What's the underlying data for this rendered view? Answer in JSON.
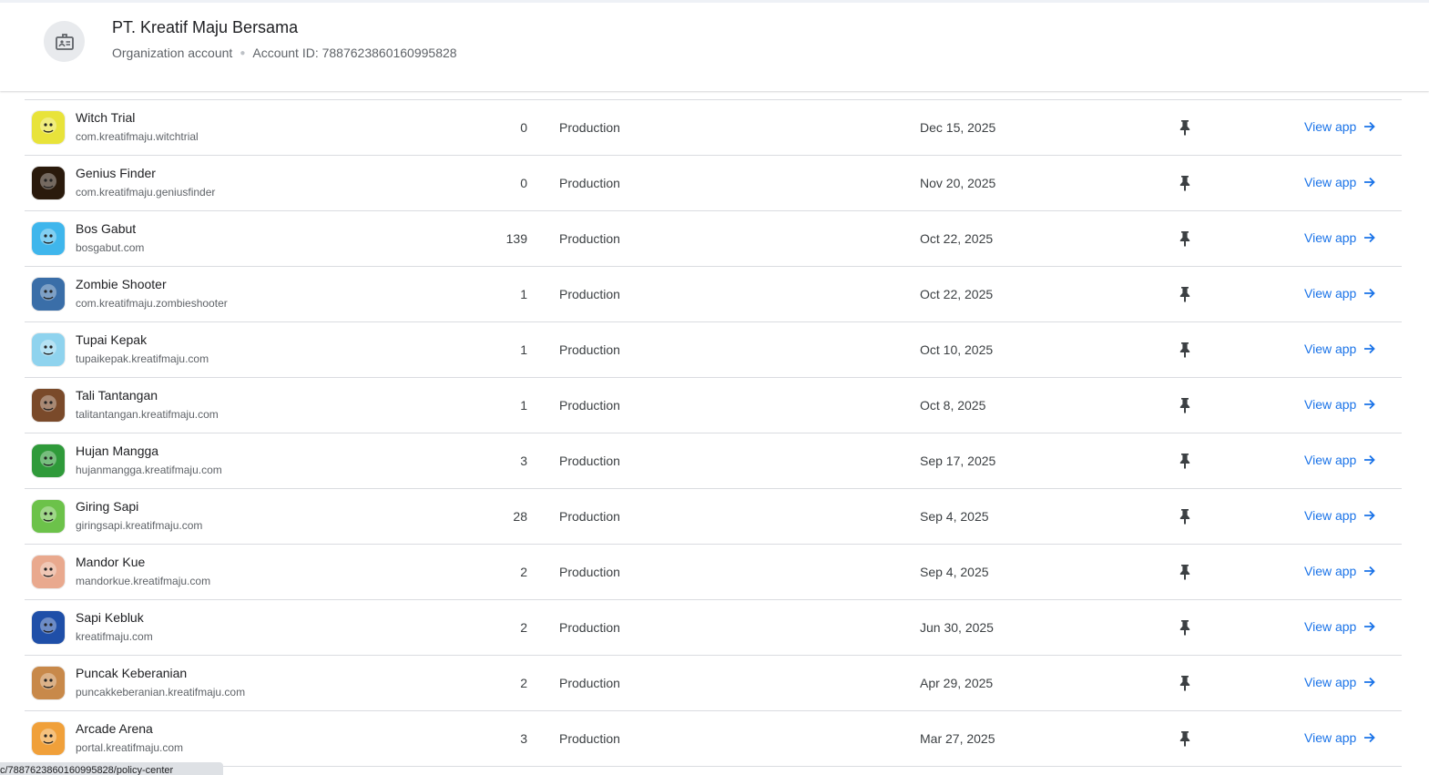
{
  "header": {
    "org_name": "PT. Kreatif Maju Bersama",
    "account_type": "Organization account",
    "account_id": "Account ID: 7887623860160995828",
    "icon": "badge-icon"
  },
  "apps": [
    {
      "name": "Witch Trial",
      "package": "com.kreatifmaju.witchtrial",
      "count": "0",
      "status": "Production",
      "date": "Dec 15, 2025",
      "action": "View app",
      "color": "#e8e33a"
    },
    {
      "name": "Genius Finder",
      "package": "com.kreatifmaju.geniusfinder",
      "count": "0",
      "status": "Production",
      "date": "Nov 20, 2025",
      "action": "View app",
      "color": "#2a1a0c"
    },
    {
      "name": "Bos Gabut",
      "package": "bosgabut.com",
      "count": "139",
      "status": "Production",
      "date": "Oct 22, 2025",
      "action": "View app",
      "color": "#3fb6ec"
    },
    {
      "name": "Zombie Shooter",
      "package": "com.kreatifmaju.zombieshooter",
      "count": "1",
      "status": "Production",
      "date": "Oct 22, 2025",
      "action": "View app",
      "color": "#3a6ea8"
    },
    {
      "name": "Tupai Kepak",
      "package": "tupaikepak.kreatifmaju.com",
      "count": "1",
      "status": "Production",
      "date": "Oct 10, 2025",
      "action": "View app",
      "color": "#8fd3ee"
    },
    {
      "name": "Tali Tantangan",
      "package": "talitantangan.kreatifmaju.com",
      "count": "1",
      "status": "Production",
      "date": "Oct 8, 2025",
      "action": "View app",
      "color": "#7a4a2a"
    },
    {
      "name": "Hujan Mangga",
      "package": "hujanmangga.kreatifmaju.com",
      "count": "3",
      "status": "Production",
      "date": "Sep 17, 2025",
      "action": "View app",
      "color": "#2f9a3a"
    },
    {
      "name": "Giring Sapi",
      "package": "giringsapi.kreatifmaju.com",
      "count": "28",
      "status": "Production",
      "date": "Sep 4, 2025",
      "action": "View app",
      "color": "#6cc24a"
    },
    {
      "name": "Mandor Kue",
      "package": "mandorkue.kreatifmaju.com",
      "count": "2",
      "status": "Production",
      "date": "Sep 4, 2025",
      "action": "View app",
      "color": "#e9a98e"
    },
    {
      "name": "Sapi Kebluk",
      "package": "kreatifmaju.com",
      "count": "2",
      "status": "Production",
      "date": "Jun 30, 2025",
      "action": "View app",
      "color": "#1f4fa8"
    },
    {
      "name": "Puncak Keberanian",
      "package": "puncakkeberanian.kreatifmaju.com",
      "count": "2",
      "status": "Production",
      "date": "Apr 29, 2025",
      "action": "View app",
      "color": "#c8894a"
    },
    {
      "name": "Arcade Arena",
      "package": "portal.kreatifmaju.com",
      "count": "3",
      "status": "Production",
      "date": "Mar 27, 2025",
      "action": "View app",
      "color": "#f0a03a"
    }
  ],
  "status_url": "c/7887623860160995828/policy-center"
}
